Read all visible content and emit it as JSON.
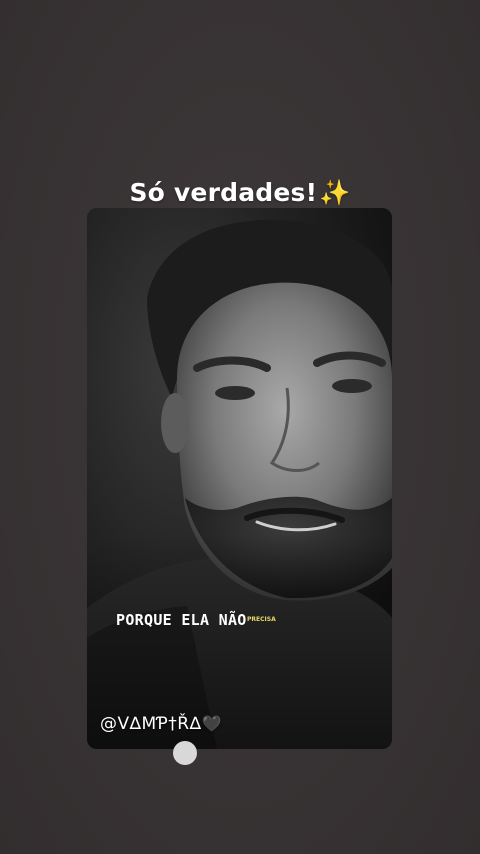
{
  "story": {
    "caption_text": "Só verdades!",
    "caption_emoji": "✨",
    "video": {
      "subtitle_current": "PORQUE ELA NÃO",
      "subtitle_next": "PRECISA",
      "handle": "@V∆MƤ†Ř∆",
      "handle_emoji": "🖤"
    }
  }
}
